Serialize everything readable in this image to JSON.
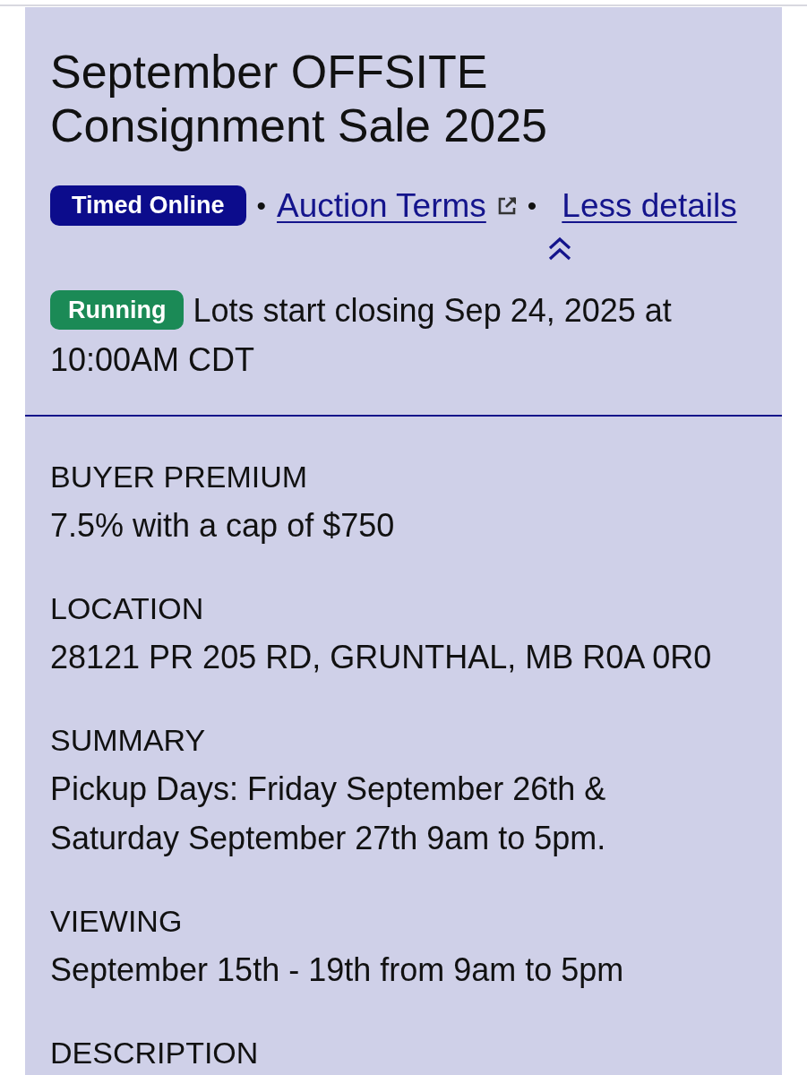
{
  "auction": {
    "title": "September OFFSITE Consignment Sale 2025",
    "meta": [
      {
        "kind": "badge",
        "text": "Timed Online"
      },
      {
        "kind": "separator",
        "text": "•"
      },
      {
        "kind": "link",
        "text": "Auction Terms",
        "external": true
      },
      {
        "kind": "separator",
        "text": "•"
      },
      {
        "kind": "toggle",
        "text": "Less details",
        "expanded": true
      }
    ],
    "status": {
      "badge": "Running",
      "text": "Lots start closing Sep 24, 2025 at 10:00AM CDT"
    }
  },
  "details": [
    {
      "label": "BUYER PREMIUM",
      "value": "7.5% with a cap of $750"
    },
    {
      "label": "LOCATION",
      "value": "28121 PR 205 RD, GRUNTHAL, MB R0A 0R0"
    },
    {
      "label": "SUMMARY",
      "value": "Pickup Days: Friday September 26th & Saturday September 27th 9am to 5pm."
    },
    {
      "label": "VIEWING",
      "value": "September 15th - 19th from 9am to 5pm"
    },
    {
      "label": "DESCRIPTION"
    }
  ]
}
